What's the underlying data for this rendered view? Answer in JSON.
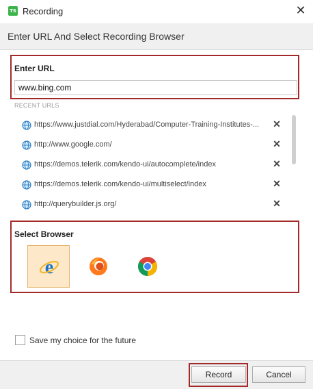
{
  "window": {
    "title": "Recording",
    "app_icon_text": "TS"
  },
  "header": {
    "title": "Enter URL And Select Recording Browser"
  },
  "url_section": {
    "label": "Enter URL",
    "value": "www.bing.com",
    "recent_label": "RECENT URLS",
    "recent_urls": [
      "https://www.justdial.com/Hyderabad/Computer-Training-Institutes-...",
      "http://www.google.com/",
      "https://demos.telerik.com/kendo-ui/autocomplete/index",
      "https://demos.telerik.com/kendo-ui/multiselect/index",
      "http://querybuilder.js.org/"
    ]
  },
  "browser_section": {
    "label": "Select Browser",
    "browsers": [
      {
        "name": "internet-explorer",
        "icon": "ie-icon",
        "selected": true
      },
      {
        "name": "firefox",
        "icon": "firefox-icon",
        "selected": false
      },
      {
        "name": "chrome",
        "icon": "chrome-icon",
        "selected": false
      }
    ]
  },
  "save_choice": {
    "label": "Save my choice for the future",
    "checked": false
  },
  "buttons": {
    "record": "Record",
    "cancel": "Cancel"
  },
  "colors": {
    "highlight_border": "#a32a2a",
    "selected_bg": "#fde9c9"
  }
}
